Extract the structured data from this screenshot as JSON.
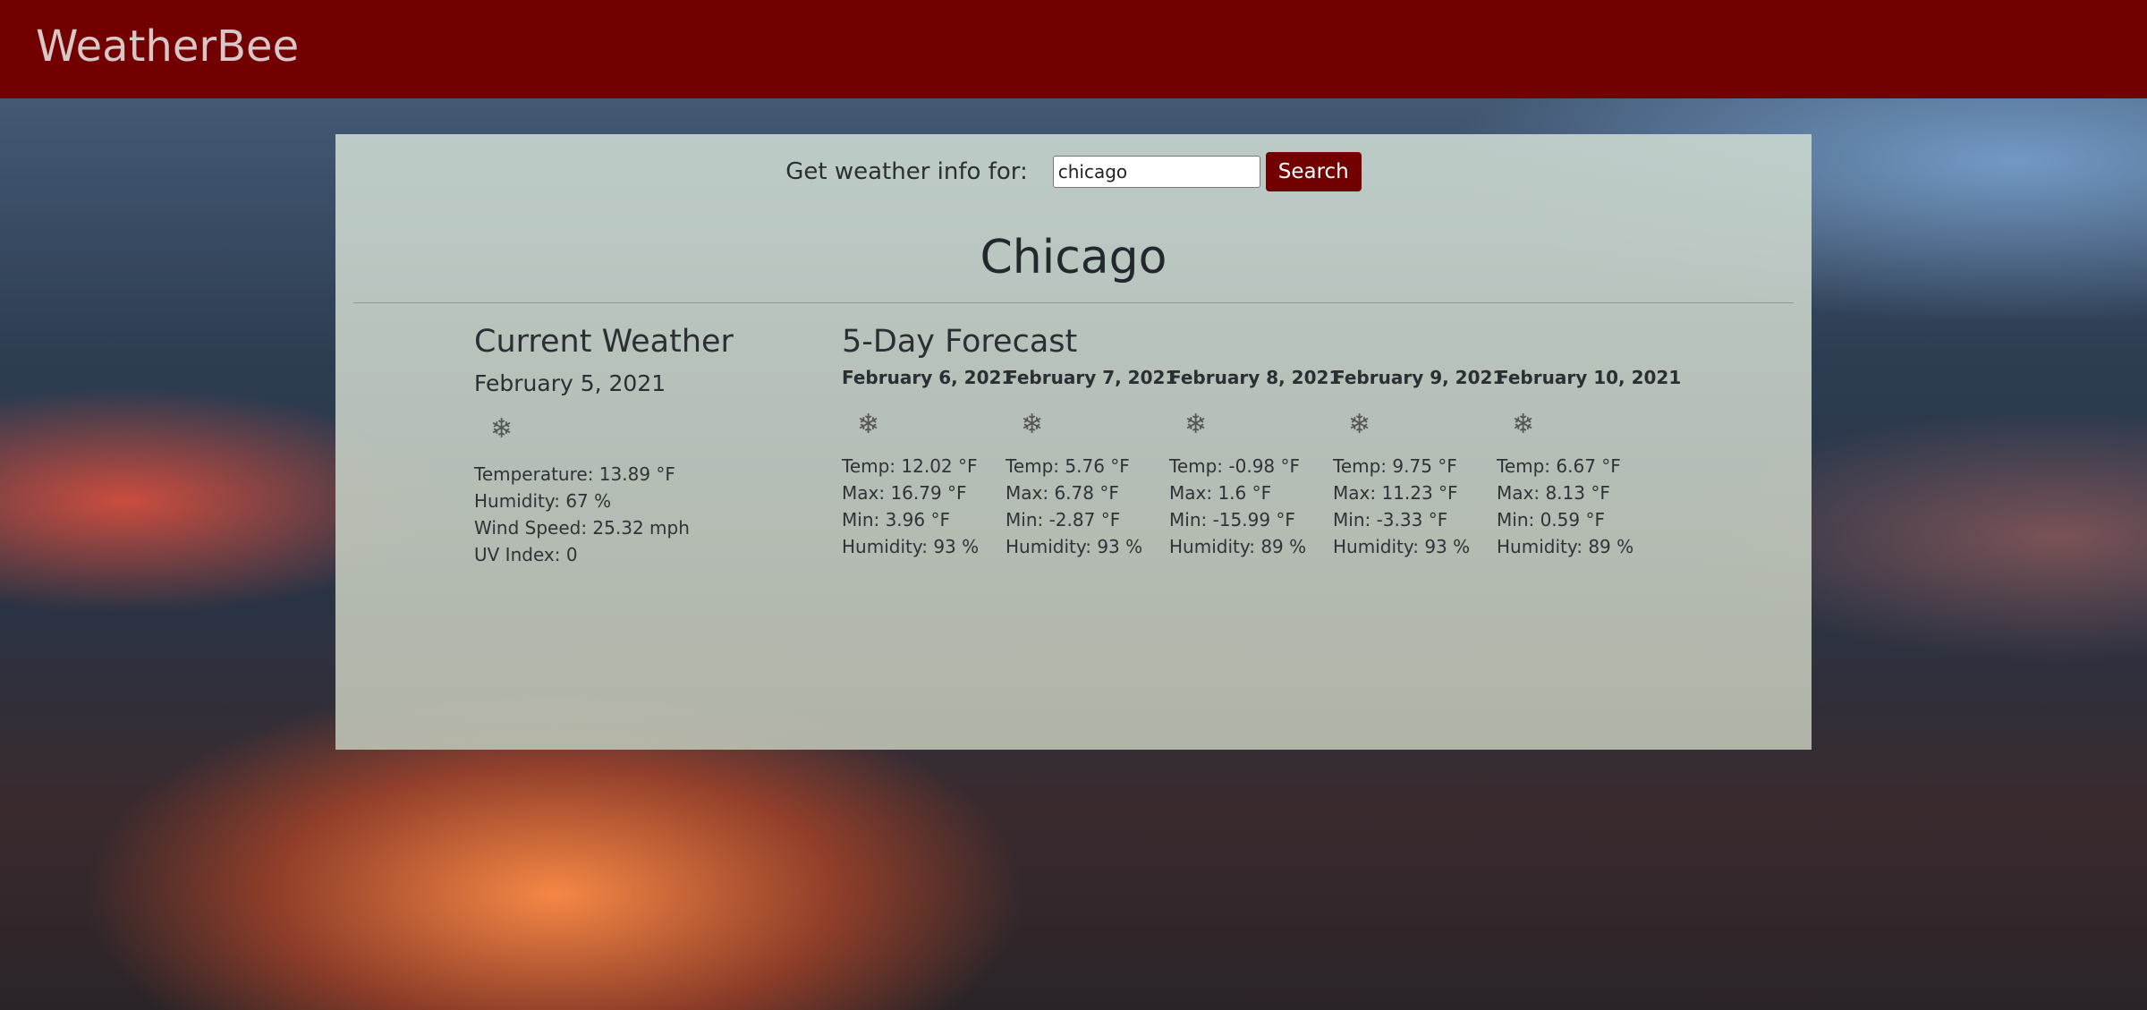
{
  "header": {
    "brand": "WeatherBee",
    "color": "#720000"
  },
  "search": {
    "label": "Get weather info for:",
    "value": "chicago",
    "button": "Search"
  },
  "city": "Chicago",
  "current": {
    "heading": "Current Weather",
    "date": "February 5, 2021",
    "icon": "snowflake-icon",
    "temperature": "Temperature: 13.89 °F",
    "humidity": "Humidity: 67 %",
    "wind": "Wind Speed: 25.32 mph",
    "uv": "UV Index: 0"
  },
  "forecast": {
    "heading": "5-Day Forecast",
    "days": [
      {
        "date": "February 6, 2021",
        "icon": "snowflake-icon",
        "temp": "Temp: 12.02 °F",
        "max": "Max: 16.79 °F",
        "min": "Min: 3.96 °F",
        "humidity": "Humidity: 93 %"
      },
      {
        "date": "February 7, 2021",
        "icon": "snowflake-icon",
        "temp": "Temp: 5.76 °F",
        "max": "Max: 6.78 °F",
        "min": "Min: -2.87 °F",
        "humidity": "Humidity: 93 %"
      },
      {
        "date": "February 8, 2021",
        "icon": "snowflake-icon",
        "temp": "Temp: -0.98 °F",
        "max": "Max: 1.6 °F",
        "min": "Min: -15.99 °F",
        "humidity": "Humidity: 89 %"
      },
      {
        "date": "February 9, 2021",
        "icon": "snowflake-icon",
        "temp": "Temp: 9.75 °F",
        "max": "Max: 11.23 °F",
        "min": "Min: -3.33 °F",
        "humidity": "Humidity: 93 %"
      },
      {
        "date": "February 10, 2021",
        "icon": "snowflake-icon",
        "temp": "Temp: 6.67 °F",
        "max": "Max: 8.13 °F",
        "min": "Min: 0.59 °F",
        "humidity": "Humidity: 89 %"
      }
    ]
  }
}
